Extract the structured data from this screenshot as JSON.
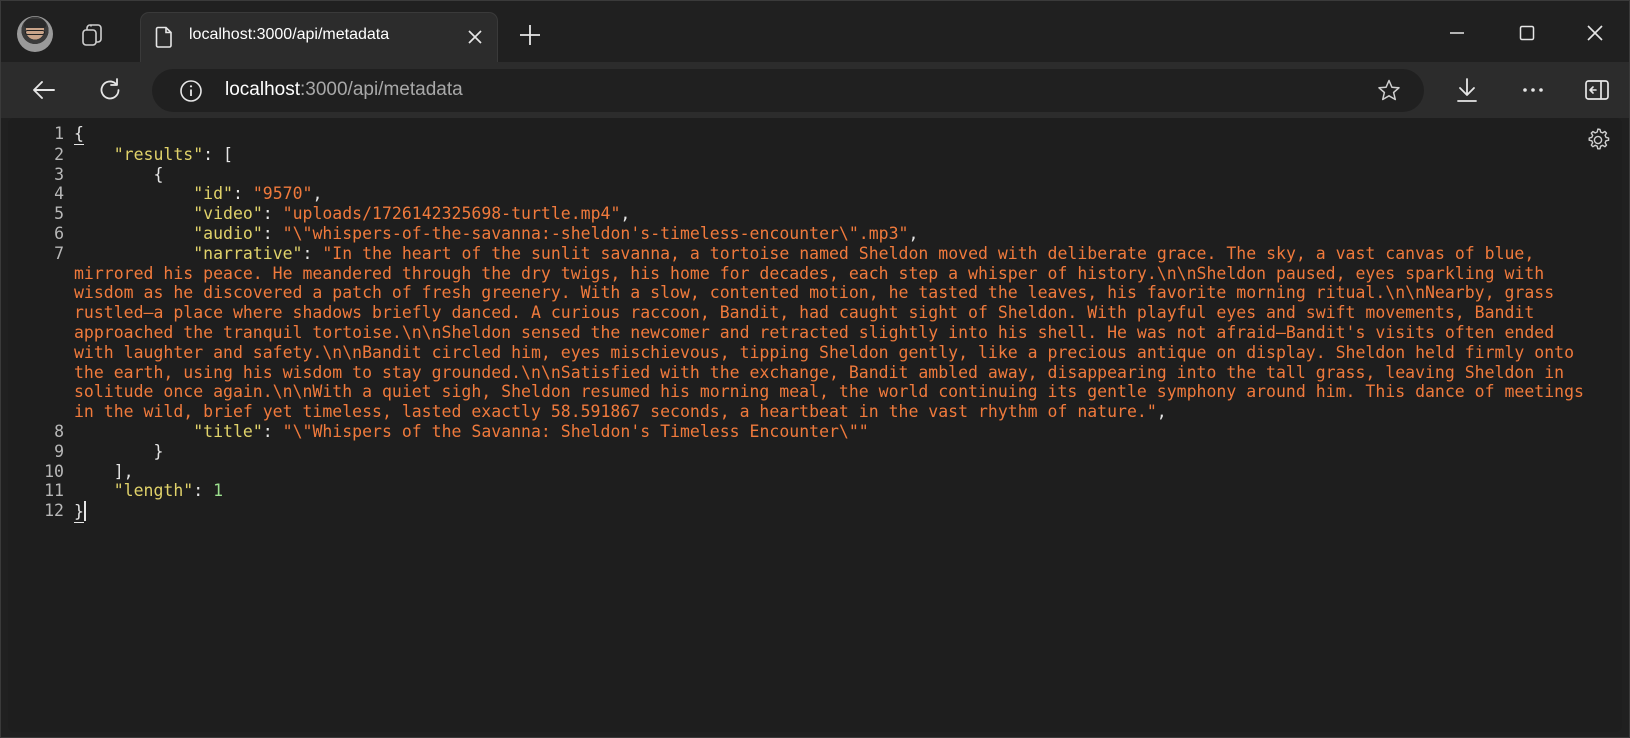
{
  "tab": {
    "title": "localhost:3000/api/metadata",
    "close_icon": "close-icon",
    "page_icon": "document-icon"
  },
  "address": {
    "host": "localhost",
    "path": ":3000/api/metadata"
  },
  "icons": {
    "avatar": "profile-avatar",
    "tab_actions": "tab-actions-icon",
    "new_tab": "plus-icon",
    "minimize": "minimize-icon",
    "maximize": "maximize-icon",
    "close": "close-icon",
    "back": "back-arrow-icon",
    "refresh": "refresh-icon",
    "site_info": "info-icon",
    "favorite": "star-icon",
    "downloads": "download-icon",
    "more": "more-icon",
    "sidebar": "sidebar-icon",
    "settings": "gear-icon"
  },
  "colors": {
    "key": "#e0d26a",
    "string": "#f07a3c",
    "number": "#9ce08e",
    "background": "#1e1e1e"
  },
  "json_view": {
    "line_numbers": [
      "1",
      "2",
      "3",
      "4",
      "5",
      "6",
      "7",
      "8",
      "9",
      "10",
      "11",
      "12"
    ],
    "open_brace": "{",
    "results_key": "\"results\"",
    "open_bracket": "[",
    "open_obj": "{",
    "id_key": "\"id\"",
    "id_value": "\"9570\"",
    "video_key": "\"video\"",
    "video_value": "\"uploads/1726142325698-turtle.mp4\"",
    "audio_key": "\"audio\"",
    "audio_value": "\"\\\"whispers-of-the-savanna:-sheldon's-timeless-encounter\\\".mp3\"",
    "narrative_key": "\"narrative\"",
    "narrative_value": "\"In the heart of the sunlit savanna, a tortoise named Sheldon moved with deliberate grace. The sky, a vast canvas of blue, mirrored his peace. He meandered through the dry twigs, his home for decades, each step a whisper of history.\\n\\nSheldon paused, eyes sparkling with wisdom as he discovered a patch of fresh greenery. With a slow, contented motion, he tasted the leaves, his favorite morning ritual.\\n\\nNearby, grass rustled—a place where shadows briefly danced. A curious raccoon, Bandit, had caught sight of Sheldon. With playful eyes and swift movements, Bandit approached the tranquil tortoise.\\n\\nSheldon sensed the newcomer and retracted slightly into his shell. He was not afraid—Bandit's visits often ended with laughter and safety.\\n\\nBandit circled him, eyes mischievous, tipping Sheldon gently, like a precious antique on display. Sheldon held firmly onto the earth, using his wisdom to stay grounded.\\n\\nSatisfied with the exchange, Bandit ambled away, disappearing into the tall grass, leaving Sheldon in solitude once again.\\n\\nWith a quiet sigh, Sheldon resumed his morning meal, the world continuing its gentle symphony around him. This dance of meetings in the wild, brief yet timeless, lasted exactly 58.591867 seconds, a heartbeat in the vast rhythm of nature.\"",
    "title_key": "\"title\"",
    "title_value": "\"\\\"Whispers of the Savanna: Sheldon's Timeless Encounter\\\"\"",
    "close_obj": "}",
    "close_bracket": "],",
    "length_key": "\"length\"",
    "length_value": "1",
    "close_brace": "}"
  }
}
